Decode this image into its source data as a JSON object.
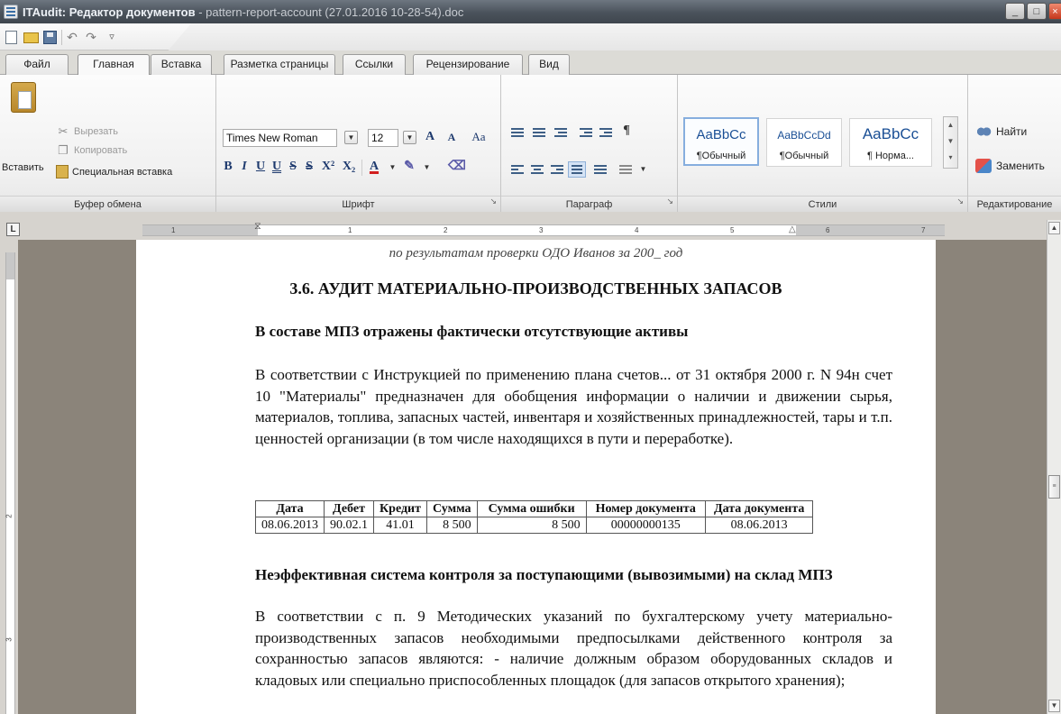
{
  "window": {
    "title_app": "ITAudit: Редактор документов",
    "title_doc": " - pattern-report-account (27.01.2016 10-28-54).doc"
  },
  "tabs": [
    "Файл",
    "Главная",
    "Вставка",
    "Разметка страницы",
    "Ссылки",
    "Рецензирование",
    "Вид"
  ],
  "active_tab": "Главная",
  "ribbon": {
    "clipboard": {
      "label": "Буфер обмена",
      "paste": "Вставить",
      "cut": "Вырезать",
      "copy": "Копировать",
      "special_paste": "Специальная вставка"
    },
    "font": {
      "label": "Шрифт",
      "font_name": "Times New Roman",
      "font_size": "12",
      "bold": "B",
      "italic": "I",
      "underline": "U",
      "double_underline": "U",
      "strike": "S",
      "double_strike": "S",
      "superscript": "X²",
      "subscript": "X₂",
      "font_color": "A",
      "grow": "A",
      "shrink": "A",
      "change_case": "Aa"
    },
    "paragraph": {
      "label": "Параграф",
      "pilcrow": "¶"
    },
    "styles": {
      "label": "Стили",
      "items": [
        {
          "sample": "AaBbCc",
          "name": "¶Обычный"
        },
        {
          "sample": "AaBbCcDd",
          "name": "¶Обычный"
        },
        {
          "sample": "AaBbCc",
          "name": "¶ Норма..."
        }
      ]
    },
    "editing": {
      "label": "Редактирование",
      "find": "Найти",
      "replace": "Заменить"
    }
  },
  "ruler": {
    "labels": [
      "1",
      "1",
      "2",
      "3",
      "4",
      "5",
      "6",
      "7"
    ],
    "v_labels": [
      "2",
      "3"
    ]
  },
  "document": {
    "running_header": "по результатам проверки ОДО Иванов за 200_ год",
    "section_title": "3.6. АУДИТ МАТЕРИАЛЬНО-ПРОИЗВОДСТВЕННЫХ ЗАПАСОВ",
    "subtitle1": "В составе МПЗ отражены фактически отсутствующие активы",
    "para1": "В соответствии с Инструкцией по применению плана счетов... от 31 октября 2000 г. N 94н счет 10 \"Материалы\" предназначен для обобщения информации о наличии и движении сырья, материалов, топлива, запасных частей, инвентаря и хозяйственных принадлежностей, тары и т.п. ценностей организации (в том числе находящихся в пути и переработке).",
    "table": {
      "headers": [
        "Дата",
        "Дебет",
        "Кредит",
        "Сумма",
        "Сумма ошибки",
        "Номер документа",
        "Дата документа"
      ],
      "rows": [
        [
          "08.06.2013",
          "90.02.1",
          "41.01",
          "8 500",
          "8 500",
          "00000000135",
          "08.06.2013"
        ]
      ]
    },
    "subtitle2": "Неэффективная система контроля за поступающими (вывозимыми) на склад МПЗ",
    "para2": "В соответствии с п. 9 Методических указаний по бухгалтерскому учету материально-производственных запасов необходимыми предпосылками действенного контроля за сохранностью запасов являются: - наличие должным образом оборудованных складов и кладовых или специально приспособленных площадок (для запасов открытого хранения);"
  }
}
